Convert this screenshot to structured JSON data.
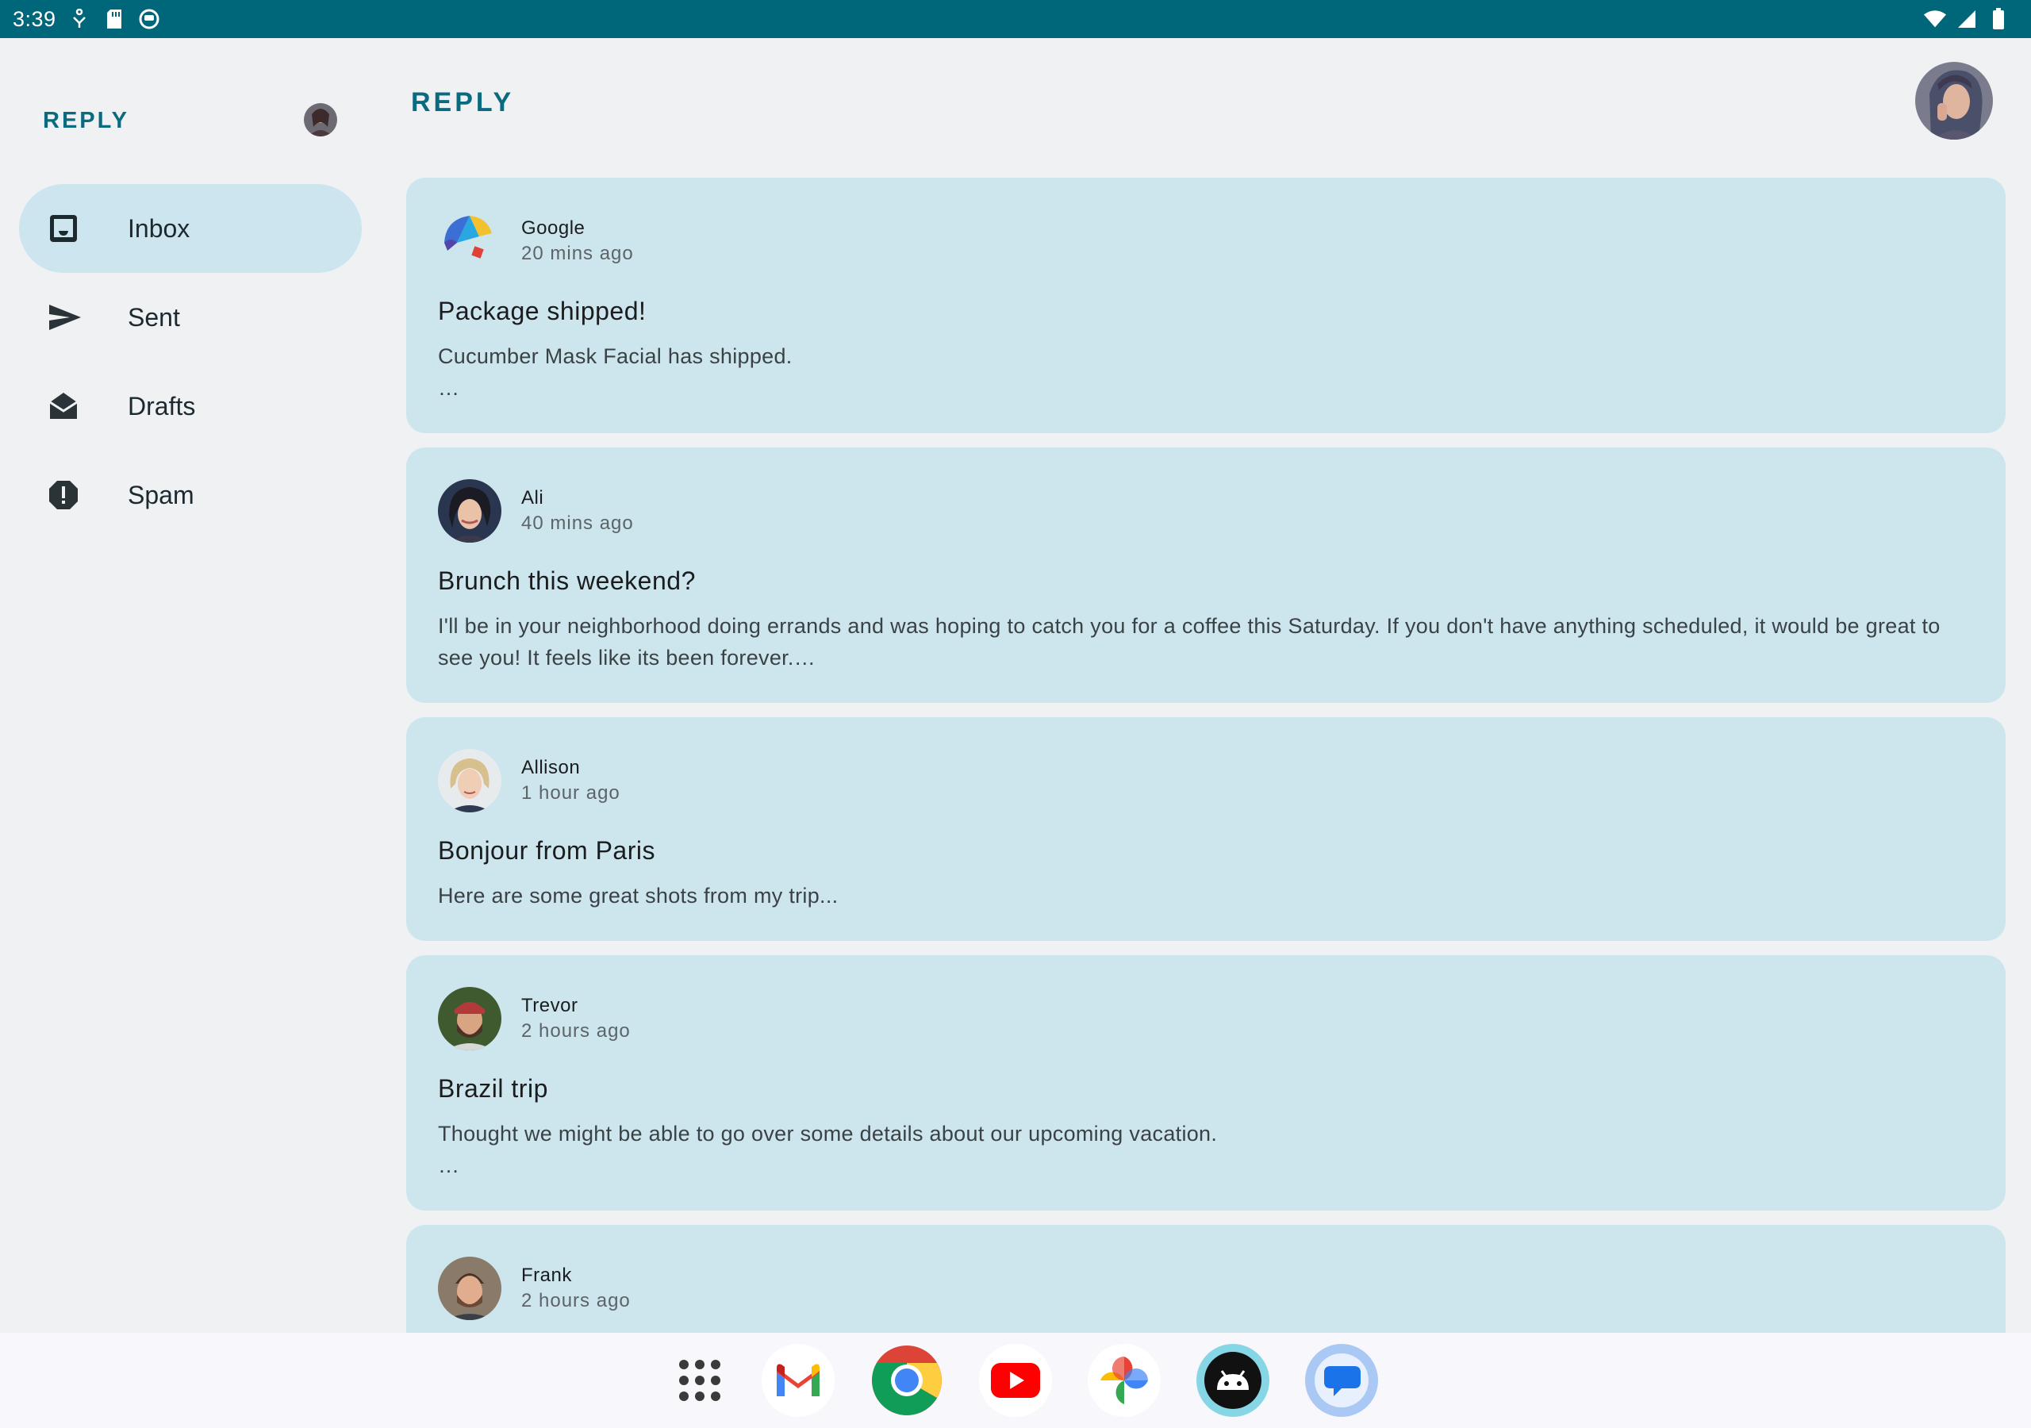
{
  "status_bar": {
    "time": "3:39",
    "left_icons": [
      "accessibility-icon",
      "sd-card-icon",
      "launcher-circle-icon"
    ],
    "right_icons": [
      "wifi-icon",
      "cell-signal-icon",
      "battery-icon"
    ]
  },
  "rail": {
    "brand": "REPLY",
    "items": [
      {
        "label": "Inbox",
        "icon": "inbox-icon",
        "active": true
      },
      {
        "label": "Sent",
        "icon": "send-icon",
        "active": false
      },
      {
        "label": "Drafts",
        "icon": "drafts-icon",
        "active": false
      },
      {
        "label": "Spam",
        "icon": "spam-icon",
        "active": false
      }
    ]
  },
  "main": {
    "title": "REPLY",
    "emails": [
      {
        "sender": "Google",
        "time": "20 mins ago",
        "subject": "Package shipped!",
        "body": "Cucumber Mask Facial has shipped.\n…"
      },
      {
        "sender": "Ali",
        "time": "40 mins ago",
        "subject": "Brunch this weekend?",
        "body": "I'll be in your neighborhood doing errands and was hoping to catch you for a coffee this Saturday. If you don't have anything scheduled, it would be great to see you! It feels like its been forever.…"
      },
      {
        "sender": "Allison",
        "time": "1 hour ago",
        "subject": "Bonjour from Paris",
        "body": "Here are some great shots from my trip..."
      },
      {
        "sender": "Trevor",
        "time": "2 hours ago",
        "subject": "Brazil trip",
        "body": "Thought we might be able to go over some details about our upcoming vacation.\n…"
      },
      {
        "sender": "Frank",
        "time": "2 hours ago",
        "subject": "",
        "body": ""
      }
    ]
  },
  "dock": {
    "apps": [
      "app-drawer-icon",
      "gmail-icon",
      "chrome-icon",
      "youtube-icon",
      "photos-icon",
      "android-icon",
      "messages-icon"
    ]
  },
  "colors": {
    "status_bar": "#006679",
    "accent": "#0a6b80",
    "card": "#cde6ee",
    "background": "#eff1f3"
  }
}
